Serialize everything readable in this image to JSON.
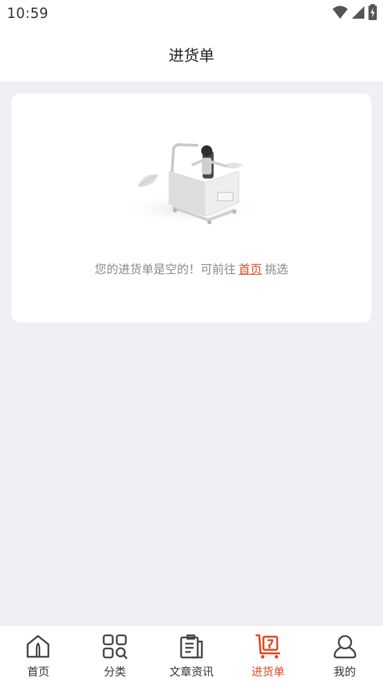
{
  "status_bar": {
    "time": "10:59",
    "icons": [
      "wifi-icon",
      "signal-icon",
      "battery-icon"
    ]
  },
  "header": {
    "title": "进货单"
  },
  "empty_state": {
    "illustration": "empty-cart-illustration",
    "message_before": "您的进货单是空的！可前往",
    "link_label": "首页",
    "message_after": "挑选"
  },
  "tab_bar": {
    "active_index": 3,
    "active_color": "#e0461e",
    "tabs": [
      {
        "label": "首页",
        "icon": "home-icon"
      },
      {
        "label": "分类",
        "icon": "category-icon"
      },
      {
        "label": "文章资讯",
        "icon": "articles-icon"
      },
      {
        "label": "进货单",
        "icon": "purchase-cart-icon"
      },
      {
        "label": "我的",
        "icon": "profile-icon"
      }
    ]
  }
}
